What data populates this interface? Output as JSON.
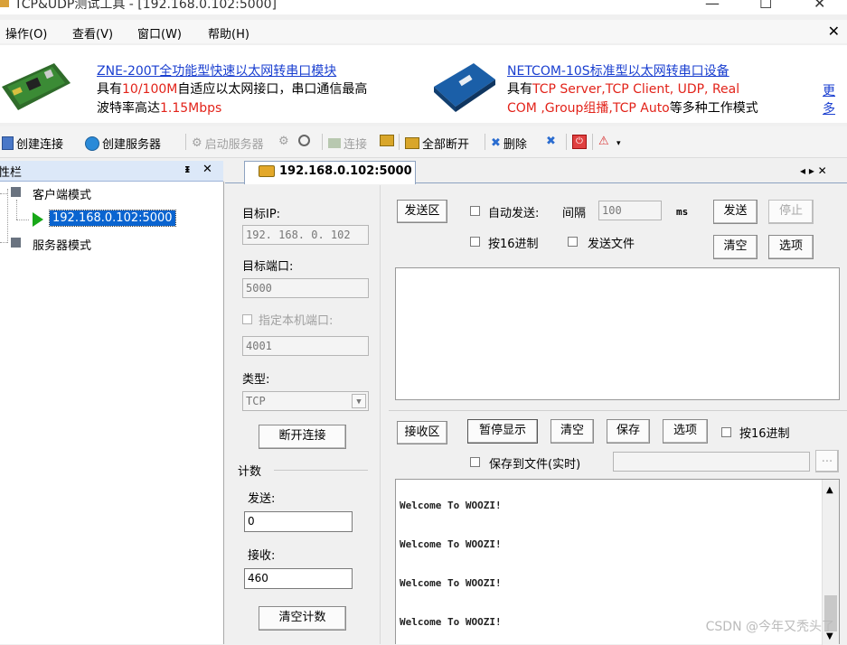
{
  "window": {
    "title": "TCP&UDP测试工具 - [192.168.0.102:5000]",
    "minimize": "—",
    "maximize": "☐",
    "close": "✕"
  },
  "menubar": {
    "items": [
      "操作(O)",
      "查看(V)",
      "窗口(W)",
      "帮助(H)"
    ],
    "close": "✕"
  },
  "banner": {
    "ad1": {
      "link": "ZNE-200T全功能型快速以太网转串口模块",
      "line2_a": "具有",
      "line2_red": "10/100M",
      "line2_b": "自适应以太网接口，串口通信最高",
      "line3_a": "波特率高达",
      "line3_red": "1.15Mbps"
    },
    "ad2": {
      "link": "NETCOM-10S标准型以太网转串口设备",
      "line2_a": "具有",
      "line2_red": "TCP Server,TCP Client, UDP, Real",
      "line3_red": "COM ,Group组播,TCP Auto",
      "line3_b": "等多种工作模式"
    },
    "more": "更多"
  },
  "toolbar": {
    "create_conn": "创建连接",
    "create_server": "创建服务器",
    "start_server": "启动服务器",
    "connect": "连接",
    "disconnect_all": "全部断开",
    "delete": "删除"
  },
  "sidebar": {
    "title": "性栏",
    "pin": "ᵻ",
    "close": "✕",
    "client_mode": "客户端模式",
    "connection": "192.168.0.102:5000",
    "server_mode": "服务器模式"
  },
  "tab": {
    "label": "192.168.0.102:5000",
    "nav": "◂ ▸ ✕"
  },
  "config": {
    "target_ip_label": "目标IP:",
    "target_ip": "192. 168. 0. 102",
    "target_port_label": "目标端口:",
    "target_port": "5000",
    "local_port_label": "指定本机端口:",
    "local_port": "4001",
    "type_label": "类型:",
    "type": "TCP",
    "disconnect": "断开连接",
    "count_label": "计数",
    "send_label": "发送:",
    "send_count": "0",
    "recv_label": "接收:",
    "recv_count": "460",
    "clear_count": "清空计数"
  },
  "send": {
    "area_label": "发送区",
    "auto_send": "自动发送:",
    "interval": "间隔",
    "interval_value": "100",
    "ms": "ms",
    "send_btn": "发送",
    "stop_btn": "停止",
    "hex": "按16进制",
    "send_file": "发送文件",
    "clear_btn": "清空",
    "options_btn": "选项"
  },
  "recv": {
    "area_label": "接收区",
    "pause": "暂停显示",
    "clear": "清空",
    "save": "保存",
    "options": "选项",
    "hex": "按16进制",
    "save_to_file": "保存到文件(实时)",
    "browse": "...",
    "lines": [
      "Welcome To WOOZI!",
      "Welcome To WOOZI!",
      "Welcome To WOOZI!",
      "Welcome To WOOZI!"
    ]
  },
  "watermark": "CSDN @今年又秃头了"
}
